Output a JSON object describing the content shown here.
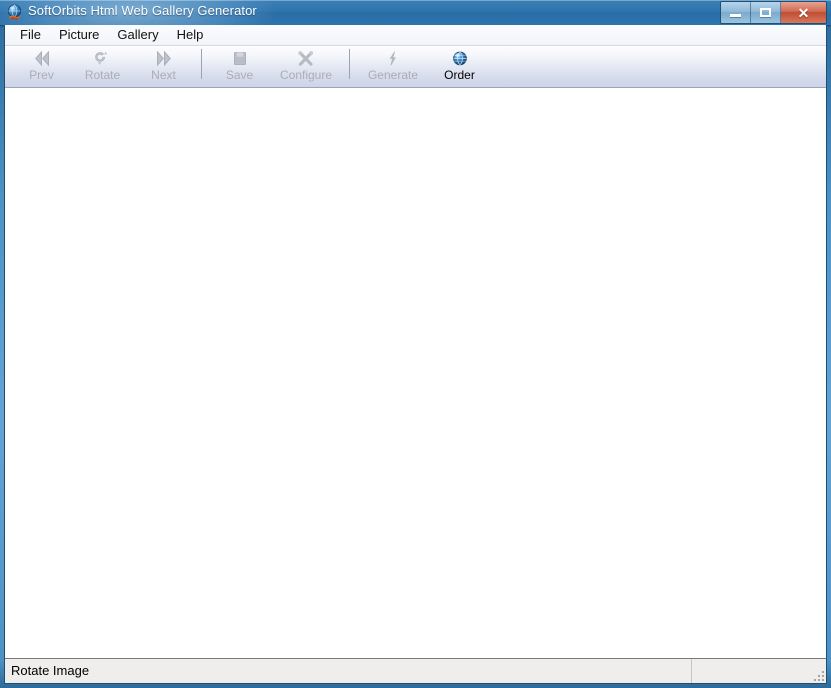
{
  "window": {
    "title": "SoftOrbits Html Web Gallery Generator",
    "app_icon": "globe-icon",
    "controls": {
      "minimize_label": "Minimize",
      "maximize_label": "Maximize",
      "close_label": "Close"
    }
  },
  "menubar": {
    "items": [
      {
        "label": "File",
        "name": "menu-file"
      },
      {
        "label": "Picture",
        "name": "menu-picture"
      },
      {
        "label": "Gallery",
        "name": "menu-gallery"
      },
      {
        "label": "Help",
        "name": "menu-help"
      }
    ]
  },
  "toolbar": {
    "buttons": [
      {
        "label": "Prev",
        "icon": "arrow-left-icon",
        "enabled": false
      },
      {
        "label": "Rotate",
        "icon": "rotate-icon",
        "enabled": false
      },
      {
        "label": "Next",
        "icon": "arrow-right-icon",
        "enabled": false
      },
      {
        "label": "Save",
        "icon": "save-disk-icon",
        "enabled": false
      },
      {
        "label": "Configure",
        "icon": "tools-cross-icon",
        "enabled": false
      },
      {
        "label": "Generate",
        "icon": "lightning-bolt-icon",
        "enabled": false
      },
      {
        "label": "Order",
        "icon": "globe-icon",
        "enabled": true
      }
    ]
  },
  "statusbar": {
    "message": "Rotate Image",
    "grip": "resize-grip-icon"
  },
  "colors": {
    "titlebar_blue": "#2f74ad",
    "frame_blue": "#4d93c6",
    "close_red": "#bf4e33",
    "toolbar_top": "#fdfdfe",
    "toolbar_bottom": "#ccd4e7",
    "disabled_text": "#a9adb6",
    "statusbar_bg": "#f0eeec",
    "canvas_bg": "#ffffff"
  }
}
